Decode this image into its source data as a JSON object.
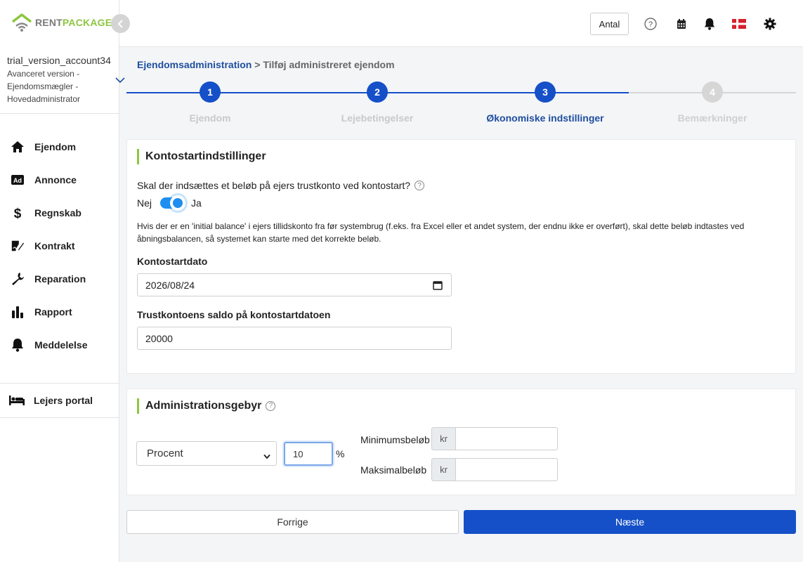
{
  "brand": {
    "rent": "RENT",
    "package": "PACKAGE",
    "accent_green": "#8dc63f",
    "accent_blue": "#1550c8"
  },
  "account": {
    "name": "trial_version_account34",
    "description_line1": "Avanceret version -",
    "description_line2": "Ejendomsmægler -",
    "description_line3": "Hovedadministrator"
  },
  "sidebar": {
    "items": [
      {
        "label": "Ejendom",
        "icon": "home-icon"
      },
      {
        "label": "Annonce",
        "icon": "ad-icon"
      },
      {
        "label": "Regnskab",
        "icon": "dollar-icon"
      },
      {
        "label": "Kontrakt",
        "icon": "contract-icon"
      },
      {
        "label": "Reparation",
        "icon": "wrench-icon"
      },
      {
        "label": "Rapport",
        "icon": "bar-chart-icon"
      },
      {
        "label": "Meddelelse",
        "icon": "bell-icon"
      }
    ],
    "portal": {
      "label": "Lejers portal",
      "icon": "bed-icon"
    }
  },
  "topbar": {
    "antal_label": "Antal"
  },
  "breadcrumb": {
    "parent": "Ejendomsadministration",
    "separator": ">",
    "current": "Tilføj administreret ejendom"
  },
  "stepper": {
    "steps": [
      {
        "number": "1",
        "label": "Ejendom",
        "state": "done"
      },
      {
        "number": "2",
        "label": "Lejebetingelser",
        "state": "done"
      },
      {
        "number": "3",
        "label": "Økonomiske indstillinger",
        "state": "active"
      },
      {
        "number": "4",
        "label": "Bemærkninger",
        "state": "todo"
      }
    ]
  },
  "kontostart": {
    "title": "Kontostartindstillinger",
    "question": "Skal der indsættes et beløb på ejers trustkonto ved kontostart?",
    "toggle_off_label": "Nej",
    "toggle_on_label": "Ja",
    "toggle_on": true,
    "info": "Hvis der er en 'initial balance' i ejers tillidskonto fra før systembrug (f.eks. fra Excel eller et andet system, der endnu ikke er overført), skal dette beløb indtastes ved åbningsbalancen, så systemet kan starte med det korrekte beløb.",
    "date_label": "Kontostartdato",
    "date_value": "2026/08/24",
    "balance_label": "Trustkontoens saldo på kontostartdatoen",
    "balance_value": "20000"
  },
  "admin_fee": {
    "title": "Administrationsgebyr",
    "type_selected": "Procent",
    "percent_value": "10",
    "percent_sign": "%",
    "min_label": "Minimumsbeløb",
    "max_label": "Maksimalbeløb",
    "currency": "kr"
  },
  "buttons": {
    "prev": "Forrige",
    "next": "Næste"
  }
}
